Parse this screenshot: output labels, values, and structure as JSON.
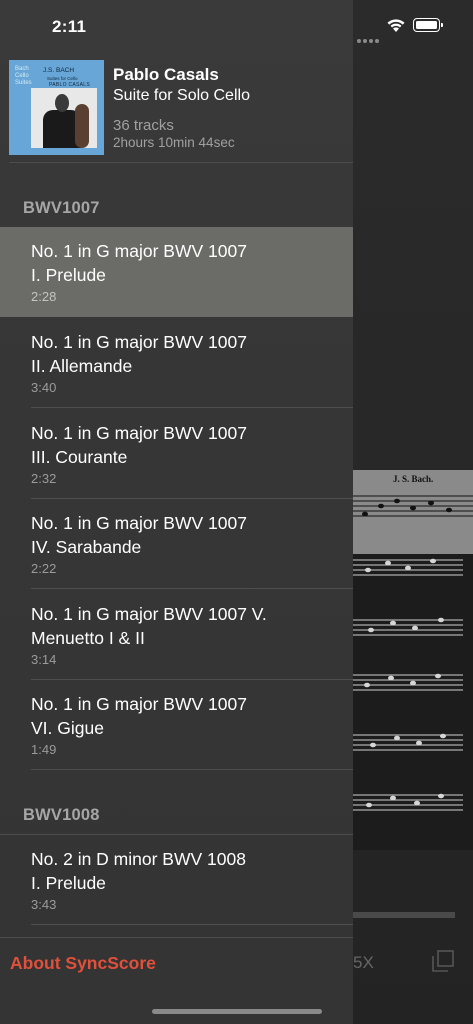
{
  "status_bar": {
    "time": "2:11"
  },
  "album": {
    "artist": "Pablo Casals",
    "title": "Suite for Solo Cello",
    "track_count": "36 tracks",
    "duration": "2hours 10min 44sec",
    "cover": {
      "top_left": "Bach Cello Suites",
      "composer": "J.S. BACH",
      "subtitle": "Suites for Cello",
      "performer": "PABLO CASALS"
    }
  },
  "sections": [
    {
      "header": "BWV1007",
      "tracks": [
        {
          "title": "No. 1 in G major BWV 1007",
          "subtitle": "I. Prelude",
          "duration": "2:28",
          "selected": true
        },
        {
          "title": "No. 1 in G major BWV 1007",
          "subtitle": "II. Allemande",
          "duration": "3:40"
        },
        {
          "title": "No. 1 in G major BWV 1007",
          "subtitle": "III. Courante",
          "duration": "2:32"
        },
        {
          "title": "No. 1 in G major BWV 1007",
          "subtitle": "IV. Sarabande",
          "duration": "2:22"
        },
        {
          "title": "No. 1 in G major BWV 1007 V.",
          "subtitle": "Menuetto I & II",
          "duration": "3:14"
        },
        {
          "title": "No. 1 in G major BWV 1007",
          "subtitle": "VI. Gigue",
          "duration": "1:49"
        }
      ]
    },
    {
      "header": "BWV1008",
      "tracks": [
        {
          "title": "No. 2 in D minor BWV 1008",
          "subtitle": "I. Prelude",
          "duration": "3:43"
        }
      ]
    }
  ],
  "footer": {
    "about_label": "About SyncScore"
  },
  "background": {
    "score_title": "J. S. Bach.",
    "speed_label": "5X"
  },
  "colors": {
    "accent": "#e0503a",
    "selected_row": "#6b6b67"
  }
}
